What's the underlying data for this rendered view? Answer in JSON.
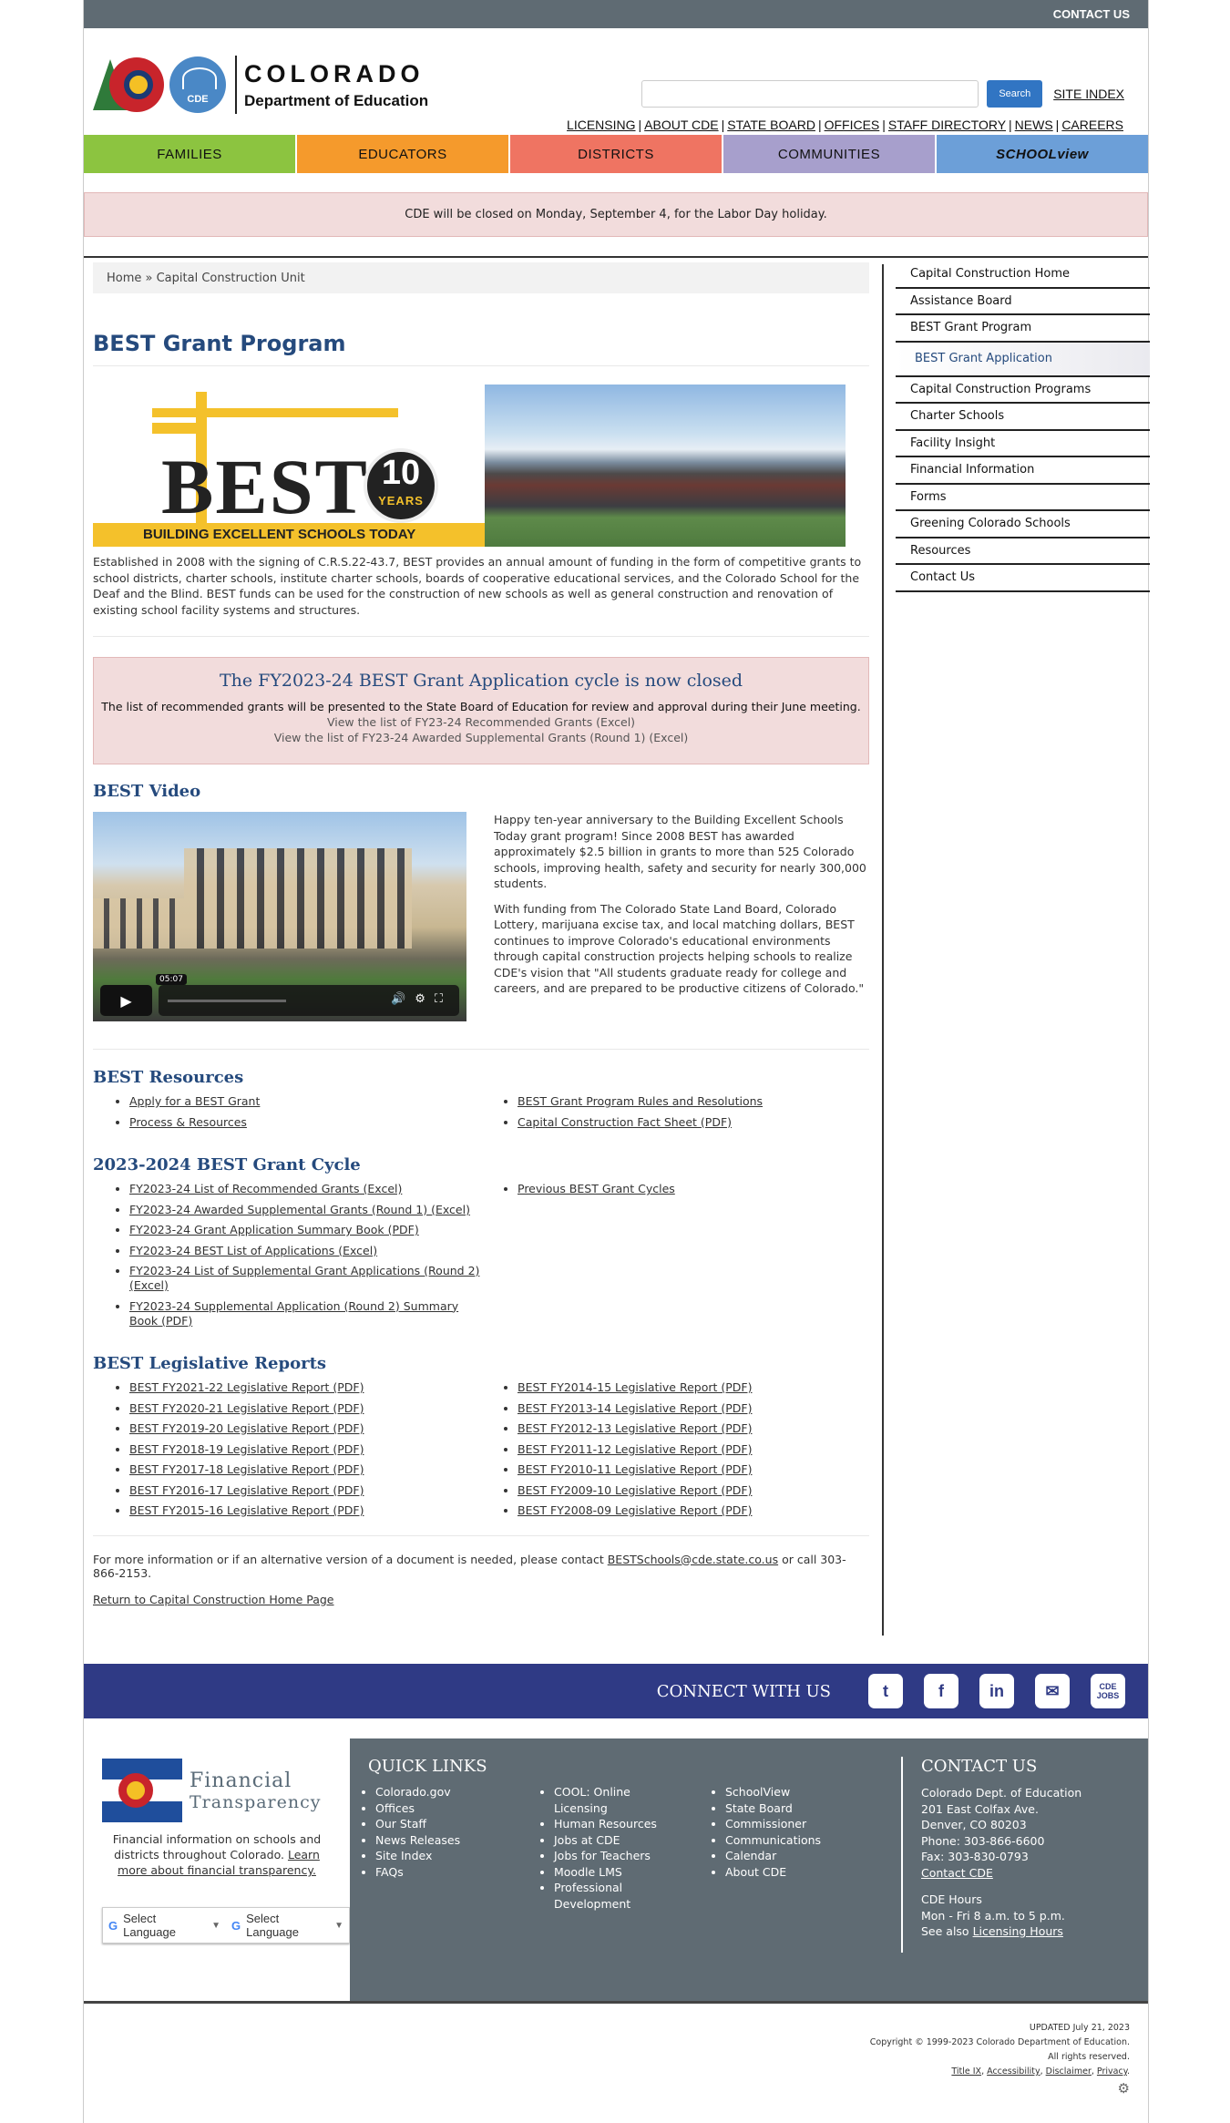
{
  "topbar": {
    "contact_us": "CONTACT US"
  },
  "header": {
    "logo_line1": "COLORADO",
    "logo_line2": "Department of Education",
    "logo_badge": "CDE",
    "search_button": "Search",
    "site_index": "SITE INDEX",
    "util_links": [
      "LICENSING",
      "ABOUT CDE",
      "STATE BOARD",
      "OFFICES",
      "STAFF DIRECTORY",
      "NEWS",
      "CAREERS"
    ]
  },
  "nav": {
    "items": [
      {
        "label": "FAMILIES",
        "color": "#8cc440"
      },
      {
        "label": "EDUCATORS",
        "color": "#f59a2c"
      },
      {
        "label": "DISTRICTS",
        "color": "#ef7462"
      },
      {
        "label": "COMMUNITIES",
        "color": "#a79fcc"
      },
      {
        "label": "SCHOOLview",
        "color": "#6c9fd8"
      }
    ]
  },
  "alert": "CDE will be closed on Monday, September 4, for the Labor Day holiday.",
  "breadcrumb": "Home » Capital Construction Unit",
  "page_title": "BEST Grant Program",
  "banner": {
    "best_word": "BEST",
    "ten": "10",
    "years": "YEARS",
    "tagline": "BUILDING EXCELLENT SCHOOLS TODAY"
  },
  "intro": "Established in 2008 with the signing of C.R.S.22-43.7, BEST provides an annual amount of funding in the form of competitive grants to school districts, charter schools, institute charter schools, boards of cooperative educational services, and the Colorado School for the Deaf and the Blind. BEST funds can be used for the construction of new schools as well as general construction and renovation of existing school facility systems and structures.",
  "closed_box": {
    "title": "The FY2023-24 BEST Grant Application cycle is now closed",
    "subtitle": "The list of recommended grants will be presented to the State Board of Education for review and approval during their June meeting.",
    "link1": "View the list of FY23-24 Recommended Grants (Excel)",
    "link2": "View the list of FY23-24 Awarded Supplemental Grants (Round 1) (Excel)"
  },
  "video_section": {
    "heading": "BEST Video",
    "time": "05:07",
    "para1": "Happy ten-year anniversary to the Building Excellent Schools Today grant program! Since 2008 BEST has awarded approximately $2.5 billion in grants to more than 525 Colorado schools, improving health, safety and security for nearly 300,000 students.",
    "para2": "With funding from The Colorado State Land Board, Colorado Lottery, marijuana excise tax, and local matching dollars, BEST continues to improve Colorado's educational environments through capital construction projects helping schools to realize CDE's vision that \"All students graduate ready for college and careers, and are prepared to be productive citizens of Colorado.\""
  },
  "resources": {
    "heading": "BEST Resources",
    "left": [
      "Apply for a BEST Grant",
      "Process & Resources"
    ],
    "right": [
      "BEST Grant Program Rules and Resolutions",
      "Capital Construction Fact Sheet (PDF)"
    ]
  },
  "cycle": {
    "heading": "2023-2024 BEST Grant Cycle",
    "left": [
      "FY2023-24 List of Recommended Grants (Excel)",
      "FY2023-24  Awarded Supplemental Grants (Round 1) (Excel)",
      "FY2023-24 Grant Application Summary Book (PDF)",
      "FY2023-24 BEST List of Applications (Excel)",
      "FY2023-24 List of Supplemental Grant Applications (Round 2) (Excel)",
      "FY2023-24 Supplemental Application (Round 2) Summary Book (PDF)"
    ],
    "right": [
      "Previous BEST Grant Cycles"
    ]
  },
  "legislative": {
    "heading": "BEST Legislative Reports",
    "left": [
      "BEST FY2021-22 Legislative Report (PDF)",
      "BEST FY2020-21 Legislative Report (PDF)",
      "BEST FY2019-20 Legislative Report (PDF)",
      "BEST FY2018-19 Legislative Report (PDF)",
      "BEST FY2017-18 Legislative Report (PDF)",
      "BEST FY2016-17 Legislative Report (PDF)",
      "BEST FY2015-16 Legislative Report (PDF)"
    ],
    "right": [
      "BEST FY2014-15 Legislative Report (PDF)",
      "BEST FY2013-14 Legislative Report (PDF)",
      "BEST FY2012-13 Legislative Report (PDF)",
      "BEST FY2011-12 Legislative Report (PDF)",
      "BEST FY2010-11 Legislative Report (PDF)",
      "BEST FY2009-10 Legislative Report (PDF)",
      "BEST FY2008-09 Legislative Report (PDF)"
    ]
  },
  "contact_line": {
    "before": "For more information or if an alternative version of a document is needed, please contact ",
    "email": "BESTSchools@cde.state.co.us",
    "after": " or call 303-866-2153."
  },
  "return_link": "Return to Capital Construction Home Page",
  "sidebar": {
    "items": [
      {
        "label": "Capital Construction Home"
      },
      {
        "label": "Assistance Board"
      },
      {
        "label": "BEST Grant Program"
      },
      {
        "label": "BEST Grant Application",
        "active": true
      },
      {
        "label": "Capital Construction Programs"
      },
      {
        "label": "Charter Schools"
      },
      {
        "label": "Facility Insight"
      },
      {
        "label": "Financial Information"
      },
      {
        "label": "Forms"
      },
      {
        "label": "Greening Colorado Schools"
      },
      {
        "label": "Resources"
      },
      {
        "label": "Contact Us"
      }
    ]
  },
  "connect": {
    "label": "CONNECT WITH US",
    "icons": [
      {
        "name": "twitter-icon",
        "glyph": "t"
      },
      {
        "name": "facebook-icon",
        "glyph": "f"
      },
      {
        "name": "linkedin-icon",
        "glyph": "in"
      },
      {
        "name": "email-icon",
        "glyph": "✉"
      },
      {
        "name": "cde-jobs-icon",
        "glyph": "CDE JOBS"
      }
    ]
  },
  "footer": {
    "fin_line1": "Financial",
    "fin_line2": "Transparency",
    "fin_desc": "Financial information on schools and districts throughout Colorado. ",
    "fin_link": "Learn more about financial transparency.",
    "lang1": "Select Language",
    "lang2": "Select Language",
    "quick_title": "QUICK LINKS",
    "ql_col1": [
      "Colorado.gov",
      "Offices",
      "Our Staff",
      "News Releases",
      "Site Index",
      "FAQs"
    ],
    "ql_col2": [
      "COOL: Online Licensing",
      "Human Resources",
      "Jobs at CDE",
      "Jobs for Teachers",
      "Moodle LMS",
      "Professional Development"
    ],
    "ql_col3": [
      "SchoolView",
      "State Board",
      "Commissioner",
      "Communications",
      "Calendar",
      "About CDE"
    ],
    "contact_title": "CONTACT US",
    "contact_lines": [
      "Colorado Dept. of Education",
      "201 East Colfax Ave.",
      "Denver, CO 80203",
      "Phone: 303-866-6600",
      "Fax: 303-830-0793"
    ],
    "contact_link": "Contact CDE",
    "hours_title": "CDE Hours",
    "hours": "Mon - Fri 8 a.m. to 5 p.m.",
    "see_also": "See also ",
    "licensing_hours": "Licensing Hours"
  },
  "legal": {
    "updated": "UPDATED July 21, 2023",
    "copyright": "Copyright © 1999-2023 Colorado Department of Education.",
    "rights": "All rights reserved.",
    "links": [
      "Title IX",
      "Accessibility",
      "Disclaimer",
      "Privacy"
    ]
  }
}
